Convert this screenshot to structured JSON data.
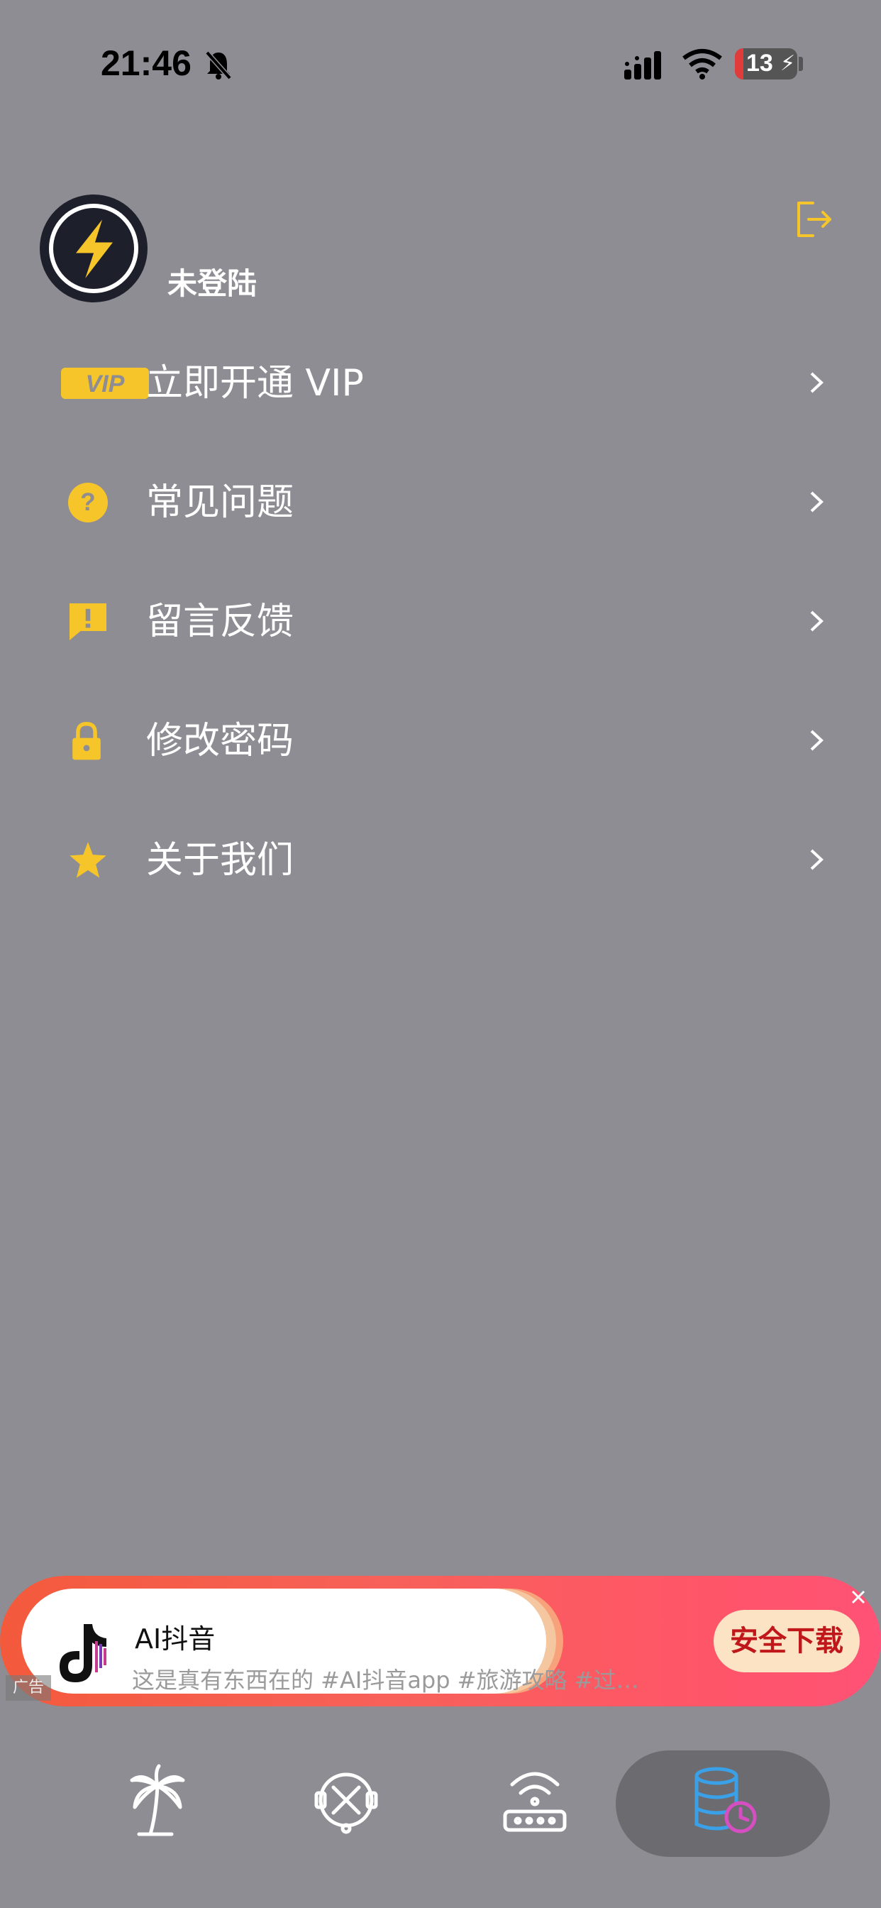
{
  "status_bar": {
    "time": "21:46",
    "battery": "13"
  },
  "profile": {
    "login_status": "未登陆"
  },
  "menu": [
    {
      "label": "立即开通 VIP",
      "icon": "vip-icon"
    },
    {
      "label": "常见问题",
      "icon": "question-icon"
    },
    {
      "label": "留言反馈",
      "icon": "feedback-icon"
    },
    {
      "label": "修改密码",
      "icon": "lock-icon"
    },
    {
      "label": "关于我们",
      "icon": "star-icon"
    }
  ],
  "ad": {
    "title": "AI抖音",
    "description": "这是真有东西在的 #AI抖音app #旅游攻略 #过…",
    "cta": "安全下载",
    "tag": "广告"
  },
  "tabbar": {
    "tabs": [
      {
        "icon": "palm-tree-icon"
      },
      {
        "icon": "tools-icon"
      },
      {
        "icon": "router-icon"
      },
      {
        "icon": "database-clock-icon",
        "active": true
      }
    ]
  },
  "colors": {
    "accent": "#f5c529",
    "background": "#8e8d93"
  }
}
